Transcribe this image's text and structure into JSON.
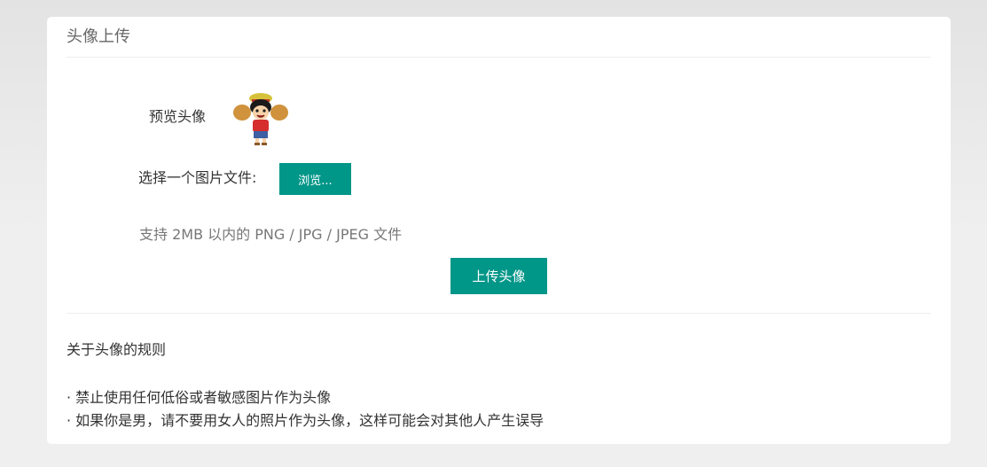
{
  "card": {
    "title": "头像上传"
  },
  "preview": {
    "label": "预览头像"
  },
  "file_select": {
    "label": "选择一个图片文件:",
    "browse_label": "浏览..."
  },
  "hint": "支持 2MB 以内的 PNG / JPG / JPEG 文件",
  "upload_button": "上传头像",
  "rules": {
    "title": "关于头像的规则",
    "items": [
      "· 禁止使用任何低俗或者敏感图片作为头像",
      "· 如果你是男，请不要用女人的照片作为头像，这样可能会对其他人产生误导"
    ]
  },
  "colors": {
    "accent": "#009688",
    "card_bg": "#ffffff",
    "page_bg": "#efefef"
  }
}
